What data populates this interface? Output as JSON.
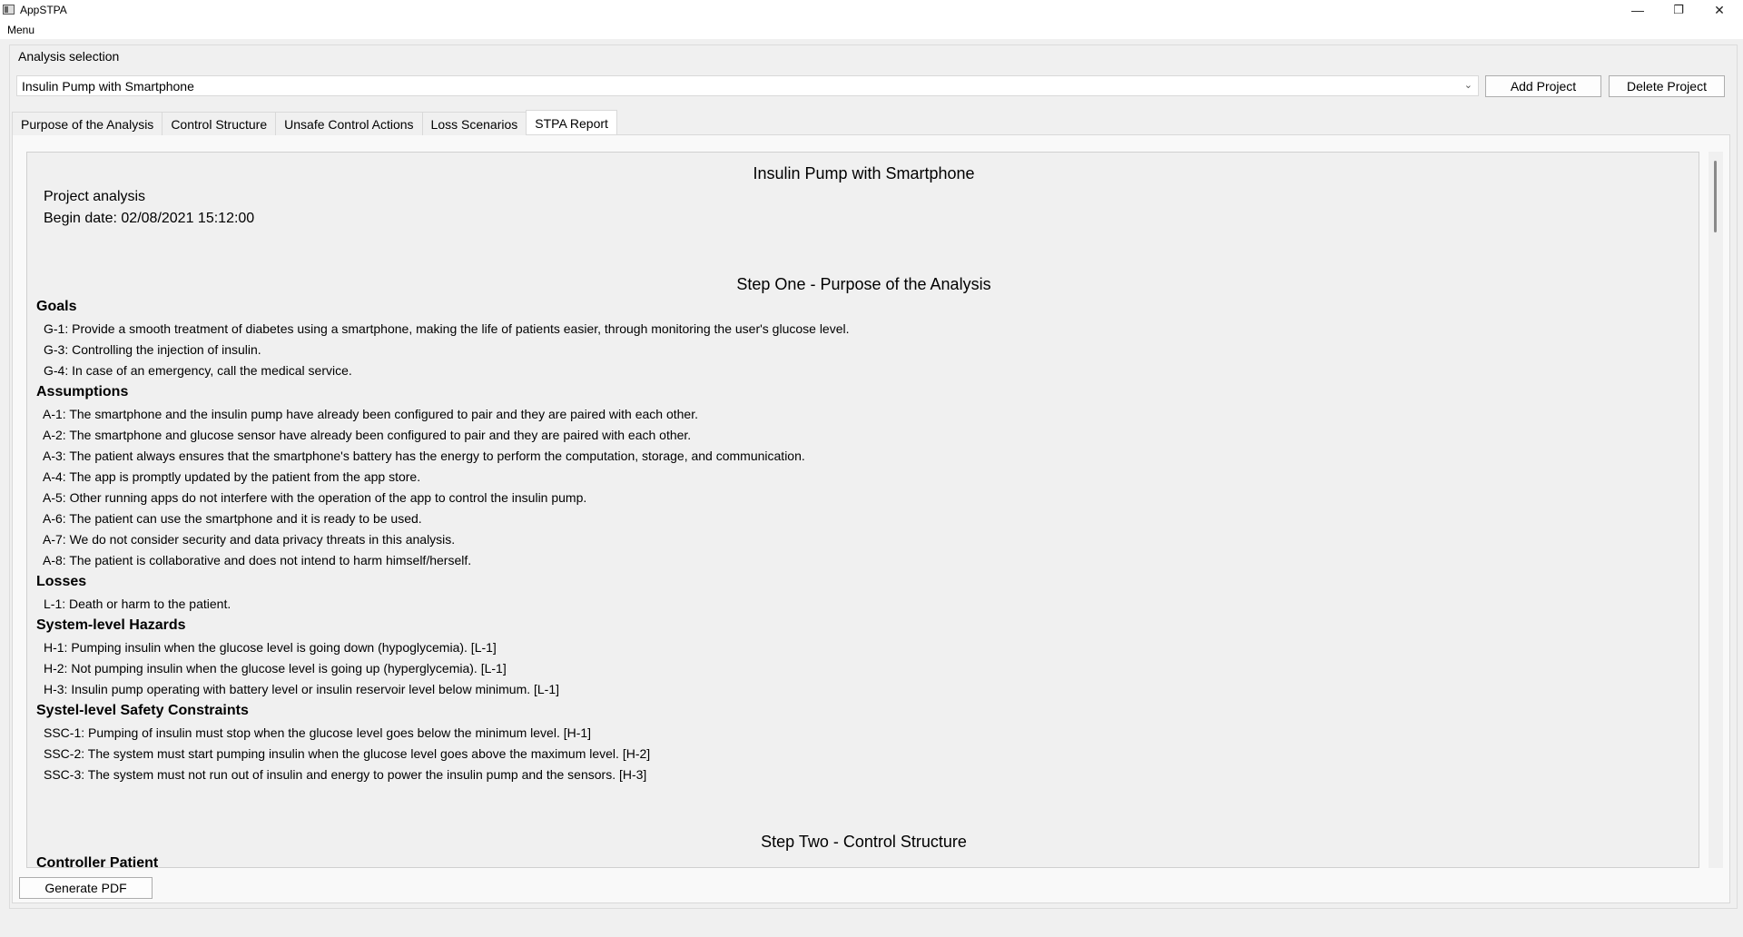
{
  "window": {
    "title": "AppSTPA",
    "controls": {
      "minimize": "—",
      "restore": "❐",
      "close": "✕"
    }
  },
  "menu": {
    "label": "Menu"
  },
  "analysis_selection": {
    "label": "Analysis selection",
    "selected_project": "Insulin Pump with Smartphone",
    "add_button": "Add Project",
    "delete_button": "Delete Project"
  },
  "tabs": [
    {
      "label": "Purpose of the Analysis"
    },
    {
      "label": "Control Structure"
    },
    {
      "label": "Unsafe Control Actions"
    },
    {
      "label": "Loss Scenarios"
    },
    {
      "label": "STPA Report",
      "active": true
    }
  ],
  "report": {
    "title": "Insulin Pump with Smartphone",
    "project_label": "Project analysis",
    "begin_date": "Begin date: 02/08/2021 15:12:00",
    "step_one": "Step One - Purpose of the Analysis",
    "goals_heading": "Goals",
    "goals": [
      "G-1: Provide a smooth treatment of diabetes using a smartphone, making the life of patients easier, through monitoring the user's glucose level.",
      "G-3: Controlling the injection of insulin.",
      "G-4: In case of an emergency, call the medical service."
    ],
    "assumptions_heading": "Assumptions",
    "assumptions": [
      "A-1: The smartphone and the insulin pump have already been configured to pair and they are paired with each other.",
      "A-2: The smartphone and glucose sensor have already been configured to pair and they are paired with each other.",
      "A-3: The patient always ensures that the smartphone's battery has the energy to perform the computation, storage, and communication.",
      "A-4: The app is promptly updated by the patient from the app store.",
      "A-5: Other running apps do not interfere with the operation of the app to control the insulin pump.",
      "A-6: The patient can use the smartphone and it is ready to be used.",
      "A-7: We do not consider security and data privacy threats in this analysis.",
      "A-8: The patient is collaborative and does not intend to harm himself/herself."
    ],
    "losses_heading": "Losses",
    "losses": [
      "L-1: Death or harm to the patient."
    ],
    "hazards_heading": "System-level Hazards",
    "hazards": [
      "H-1: Pumping insulin when the glucose level is going down (hypoglycemia). [L-1]",
      "H-2: Not pumping insulin when the glucose level is going up (hyperglycemia). [L-1]",
      "H-3: Insulin pump operating with battery level or insulin reservoir level below minimum. [L-1]"
    ],
    "constraints_heading": "Systel-level Safety Constraints",
    "constraints": [
      "SSC-1: Pumping of insulin must stop when the glucose level goes below the minimum level. [H-1]",
      "SSC-2: The system must start pumping insulin when the glucose level goes above the maximum level. [H-2]",
      "SSC-3: The system must not run out of insulin and energy to power the insulin pump and the sensors. [H-3]"
    ],
    "step_two": "Step Two - Control Structure",
    "controller_heading": "Controller Patient"
  },
  "generate_pdf_button": "Generate PDF"
}
